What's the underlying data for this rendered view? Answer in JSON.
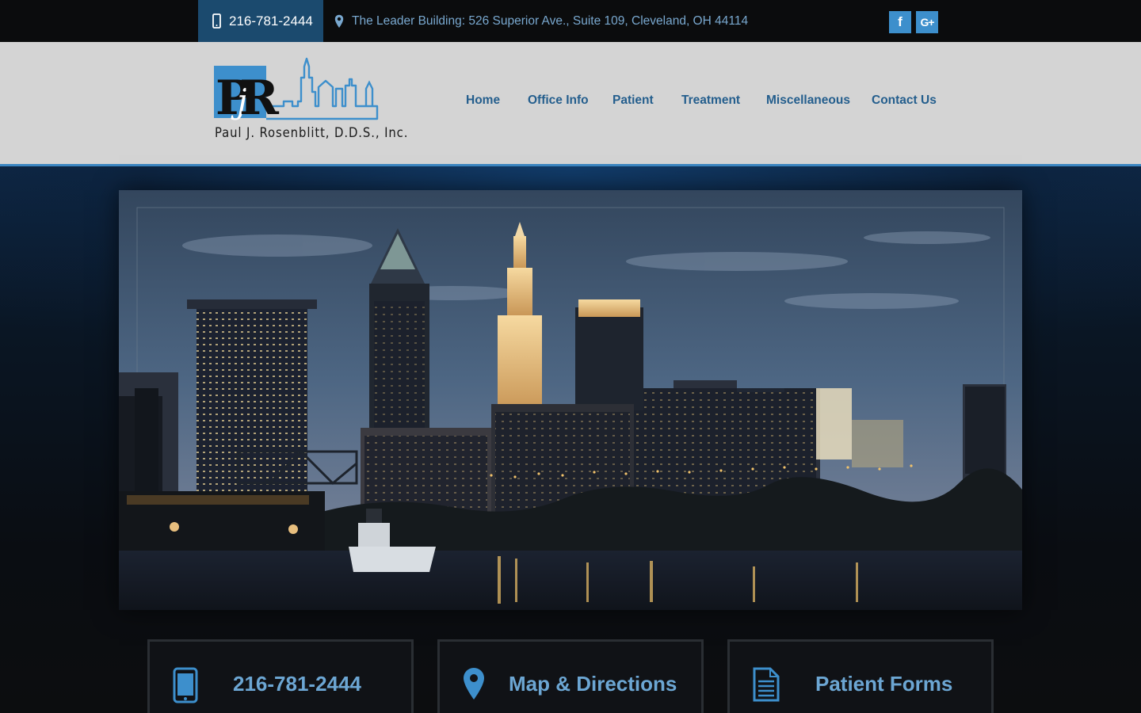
{
  "topbar": {
    "phone": "216-781-2444",
    "address": "The Leader Building: 526 Superior Ave., Suite 109, Cleveland, OH 44114",
    "social": [
      {
        "icon": "facebook-icon",
        "label": "f"
      },
      {
        "icon": "google-plus-icon",
        "label": "G+"
      }
    ]
  },
  "header": {
    "logo_monogram": "PjR",
    "logo_name": "Paul J. Rosenblitt, D.D.S., Inc.",
    "nav": [
      "Home",
      "Office Info",
      "Patient",
      "Treatment",
      "Miscellaneous",
      "Contact Us"
    ]
  },
  "hero": {
    "image_subject": "Cleveland skyline at dusk over river"
  },
  "features": [
    {
      "icon": "phone-icon",
      "label": "216-781-2444"
    },
    {
      "icon": "map-pin-icon",
      "label": "Map & Directions"
    },
    {
      "icon": "document-icon",
      "label": "Patient Forms"
    }
  ],
  "colors": {
    "topbar_bg": "#0b0c0d",
    "phone_bg": "#1b4a6e",
    "accent": "#3b86c2",
    "nav_text": "#245e8d",
    "header_bg": "#d4d4d4",
    "feature_text": "#6ca6d3"
  }
}
